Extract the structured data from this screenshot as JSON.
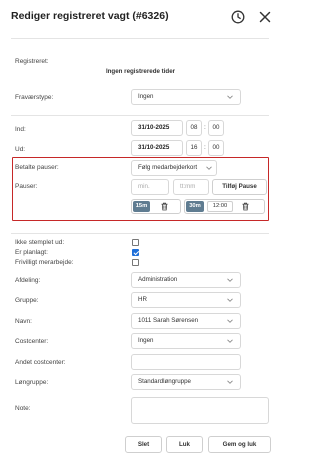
{
  "dialog": {
    "title": "Rediger registreret vagt (#6326)"
  },
  "registered": {
    "label": "Registreret:",
    "value": "Ingen registrerede tider"
  },
  "absence_type": {
    "label": "Fraværstype:",
    "value": "Ingen"
  },
  "check_in": {
    "label": "Ind:",
    "date": "31/10-2025",
    "hour": "08",
    "minute": "00"
  },
  "check_out": {
    "label": "Ud:",
    "date": "31/10-2025",
    "hour": "16",
    "minute": "00"
  },
  "paid_breaks": {
    "label": "Betalte pauser:",
    "value": "Følg medarbejderkort"
  },
  "breaks": {
    "label": "Pauser:",
    "min_placeholder": "min.",
    "time_placeholder": "tt:mm",
    "add_label": "Tilføj Pause",
    "items": [
      {
        "minutes": "15m",
        "time": ""
      },
      {
        "minutes": "30m",
        "time": "12:00"
      }
    ]
  },
  "not_checked_out": {
    "label": "Ikke stemplet ud:",
    "checked": false
  },
  "planned": {
    "label": "Er planlagt:",
    "checked": true
  },
  "voluntary_overtime": {
    "label": "Frivilligt merarbejde:",
    "checked": false
  },
  "department": {
    "label": "Afdeling:",
    "value": "Administration"
  },
  "group": {
    "label": "Gruppe:",
    "value": "HR"
  },
  "name": {
    "label": "Navn:",
    "value": "1011 Sarah Sørensen"
  },
  "costcenter": {
    "label": "Costcenter:",
    "value": "Ingen"
  },
  "other_costcenter": {
    "label": "Andet costcenter:",
    "value": ""
  },
  "wage_group": {
    "label": "Løngruppe:",
    "value": "Standardløngruppe"
  },
  "note": {
    "label": "Note:",
    "value": ""
  },
  "footer": {
    "delete_label": "Slet",
    "close_label": "Luk",
    "save_close_label": "Gem og luk"
  },
  "colors": {
    "highlight_border": "#c62828",
    "chip_bg": "#5f7c91",
    "checkbox_checked": "#1e6fd9"
  }
}
